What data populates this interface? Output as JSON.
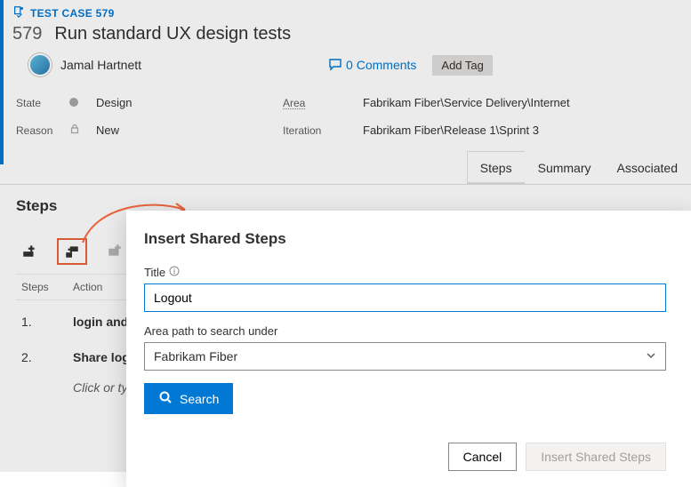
{
  "workitem": {
    "type_label": "TEST CASE 579",
    "id": "579",
    "title": "Run standard UX design tests",
    "assignee": "Jamal Hartnett",
    "comments_label": "0 Comments",
    "add_tag_label": "Add Tag"
  },
  "fields": {
    "state_label": "State",
    "state_value": "Design",
    "reason_label": "Reason",
    "reason_value": "New",
    "area_label": "Area",
    "area_value": "Fabrikam Fiber\\Service Delivery\\Internet",
    "iteration_label": "Iteration",
    "iteration_value": "Fabrikam Fiber\\Release 1\\Sprint 3"
  },
  "tabs": {
    "steps": "Steps",
    "summary": "Summary",
    "associated": "Associated"
  },
  "steps_section": {
    "heading": "Steps",
    "col_steps": "Steps",
    "col_action": "Action",
    "rows": [
      {
        "num": "1.",
        "action": "login and o"
      },
      {
        "num": "2.",
        "action": "Share log-"
      }
    ],
    "placeholder": "Click or type"
  },
  "dialog": {
    "title": "Insert Shared Steps",
    "title_field_label": "Title",
    "title_field_value": "Logout",
    "area_field_label": "Area path to search under",
    "area_field_value": "Fabrikam Fiber",
    "search_label": "Search",
    "cancel_label": "Cancel",
    "insert_label": "Insert Shared Steps"
  }
}
